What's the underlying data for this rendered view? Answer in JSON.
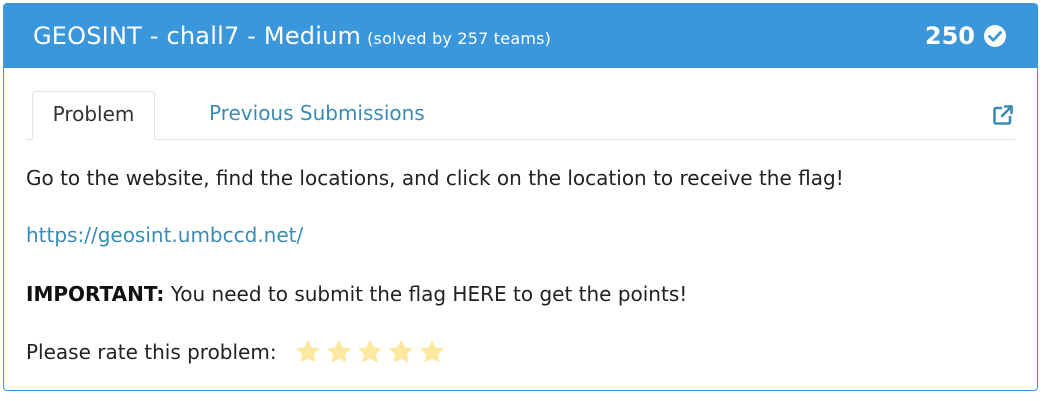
{
  "header": {
    "title": "GEOSINT - chall7 - Medium",
    "solved_text": "(solved by 257 teams)",
    "points": "250",
    "background_color": "#3a97db"
  },
  "tabs": [
    {
      "label": "Problem",
      "active": true
    },
    {
      "label": "Previous Submissions",
      "active": false
    }
  ],
  "content": {
    "description": "Go to the website, find the locations, and click on the location to receive the flag!",
    "link": "https://geosint.umbccd.net/",
    "important_label": "IMPORTANT:",
    "important_text": " You need to submit the flag HERE to get the points!",
    "rate_label": "Please rate this problem:"
  },
  "rating": {
    "star_count": 5,
    "selected": 0,
    "star_color": "#fde8a0"
  },
  "icons": {
    "solved": "check-circle-icon",
    "external": "external-link-icon",
    "rating": "star-icon"
  }
}
